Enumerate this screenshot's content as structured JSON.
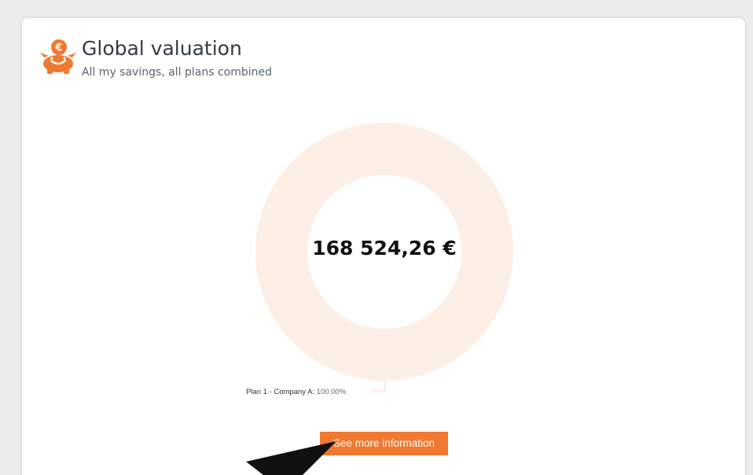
{
  "header": {
    "title": "Global valuation",
    "subtitle": "All my savings, all plans combined",
    "icon": "piggy-bank-euro-icon"
  },
  "chart_data": {
    "type": "pie",
    "center_label": "168 524,26 €",
    "slices": [
      {
        "label": "Plan 1 - Company A",
        "percent": 100.0,
        "percent_text": "100.00%"
      }
    ]
  },
  "actions": {
    "more_label": "See more information"
  },
  "colors": {
    "accent": "#f07830",
    "ring": "#fcefe6",
    "background": "#ececec"
  }
}
